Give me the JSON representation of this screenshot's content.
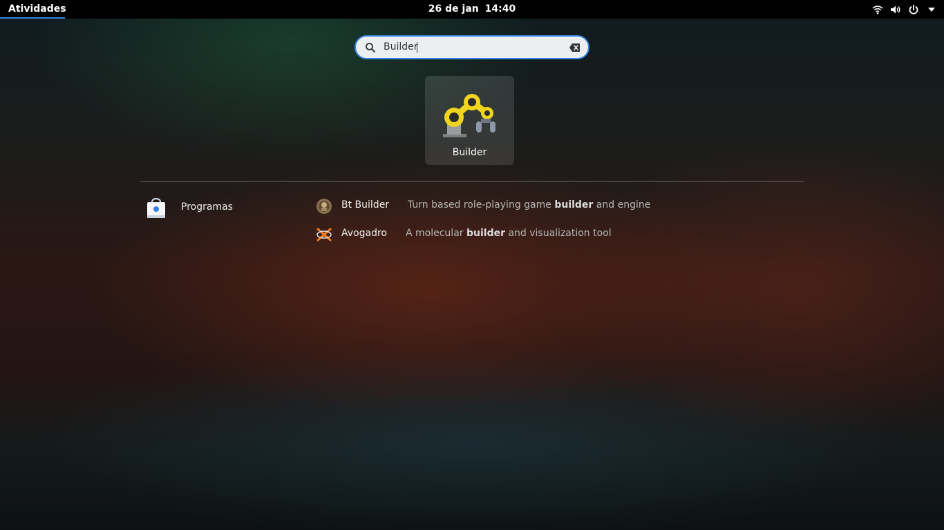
{
  "topbar": {
    "activities": "Atividades",
    "date": "26 de jan",
    "time": "14:40",
    "icons": [
      "wifi-icon",
      "volume-icon",
      "power-icon",
      "menu-arrow-icon"
    ]
  },
  "search": {
    "value": "Builder",
    "icons": [
      "search-icon",
      "clear-icon"
    ]
  },
  "top_result": {
    "label": "Builder",
    "icon": "builder-app-icon"
  },
  "provider": {
    "label": "Programas",
    "icon": "software-store-icon"
  },
  "results": [
    {
      "name": "Bt Builder",
      "icon": "bt-builder-icon",
      "desc_before": "Turn based role-playing game ",
      "desc_match": "builder",
      "desc_after": " and engine"
    },
    {
      "name": "Avogadro",
      "icon": "avogadro-icon",
      "desc_before": "A molecular ",
      "desc_match": "builder",
      "desc_after": " and visualization tool"
    }
  ],
  "colors": {
    "accent": "#3584e4",
    "topbar": "#000000",
    "search_bg": "#edeef0"
  }
}
